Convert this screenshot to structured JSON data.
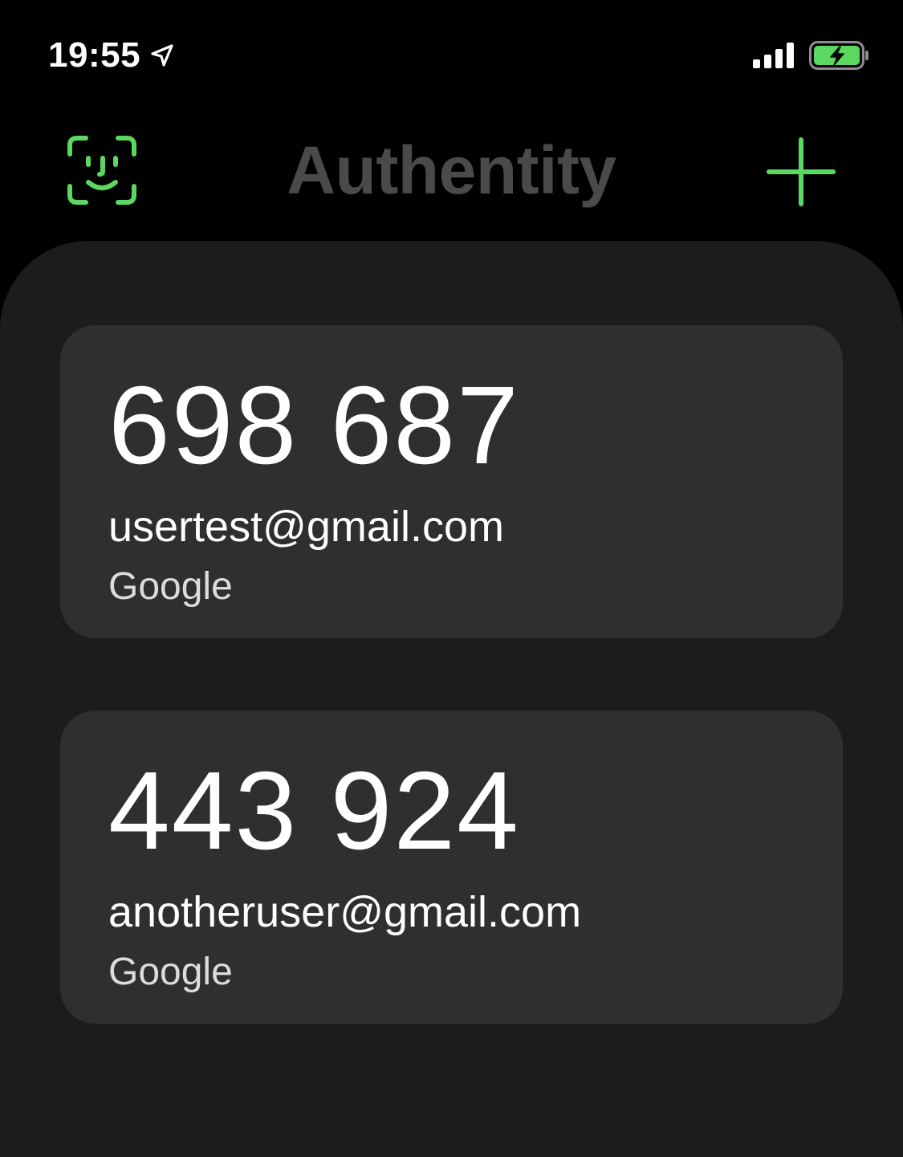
{
  "status_bar": {
    "time": "19:55",
    "icons": [
      "location-arrow-icon",
      "cellular-signal-icon",
      "battery-charging-icon"
    ]
  },
  "header": {
    "title": "Authentity",
    "left_icon": "face-id-icon",
    "right_icon": "plus-icon"
  },
  "accounts": [
    {
      "code": "698 687",
      "account": "usertest@gmail.com",
      "issuer": "Google"
    },
    {
      "code": "443 924",
      "account": "anotheruser@gmail.com",
      "issuer": "Google"
    }
  ],
  "colors": {
    "accent": "#5ad85f",
    "title": "#4a4a4a",
    "background": "#000000",
    "panel": "#1c1c1e",
    "card": "#2f2f2f",
    "battery_fill": "#5ad85f"
  }
}
